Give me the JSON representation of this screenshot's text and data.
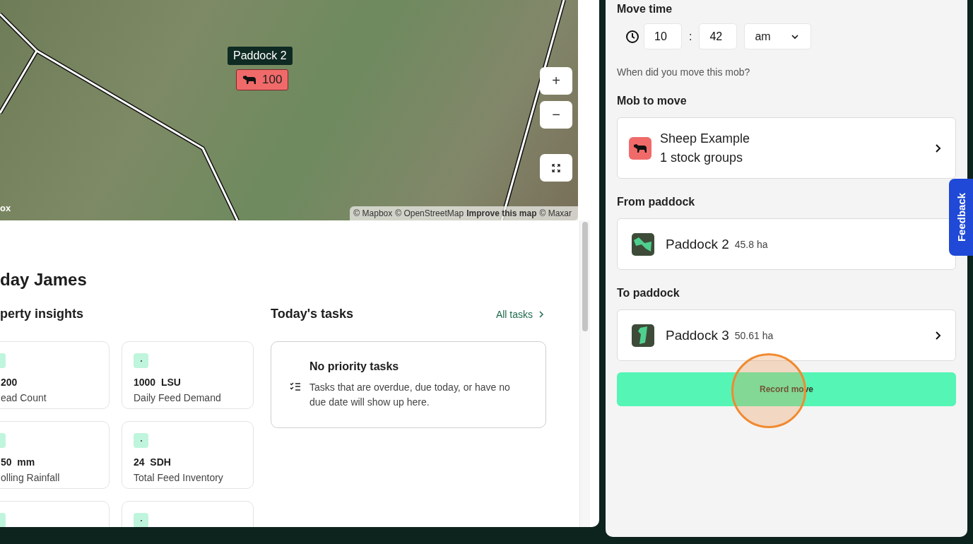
{
  "map": {
    "paddock_label": "Paddock 2",
    "mob_badge": {
      "count": "100",
      "color": "#f06a6a"
    },
    "logo_text": "ox",
    "controls": [
      "+",
      "−"
    ],
    "attribution": [
      {
        "text": "© Mapbox",
        "bold": false
      },
      {
        "text": "© OpenStreetMap",
        "bold": false
      },
      {
        "text": "Improve this map",
        "bold": true
      },
      {
        "text": "© Maxar",
        "bold": false
      }
    ]
  },
  "greeting": "day James",
  "insights": {
    "title": "perty insights",
    "cards": [
      {
        "kind": "stat",
        "value": "200",
        "label": "ead Count"
      },
      {
        "kind": "stat",
        "value": "1000",
        "unit": "LSU",
        "label": "Daily Feed Demand"
      },
      {
        "kind": "stat",
        "value": "50",
        "unit": "mm",
        "label": "olling Rainfall"
      },
      {
        "kind": "stat",
        "value": "24",
        "unit": "SDH",
        "label": "Total Feed Inventory"
      },
      {
        "kind": "cut"
      },
      {
        "kind": "cut"
      }
    ]
  },
  "tasks": {
    "title": "Today's tasks",
    "link": "All tasks",
    "empty_title": "No priority tasks",
    "empty_text": "Tasks that are overdue, due today, or have no due date will show up here."
  },
  "form": {
    "move_time": {
      "label": "Move time",
      "hour": "10",
      "separator": ":",
      "minute": "42",
      "period": "am",
      "hint": "When did you move this mob?"
    },
    "mob": {
      "label": "Mob to move",
      "name": "Sheep Example",
      "detail": "1 stock groups",
      "color": "#f06a6a"
    },
    "from": {
      "label": "From paddock",
      "name": "Paddock 2",
      "area": "45.8 ha",
      "chevron": false
    },
    "to": {
      "label": "To paddock",
      "name": "Paddock 3",
      "area": "50.61 ha",
      "chevron": true
    },
    "submit": "Record move"
  },
  "feedback": "Feedback"
}
